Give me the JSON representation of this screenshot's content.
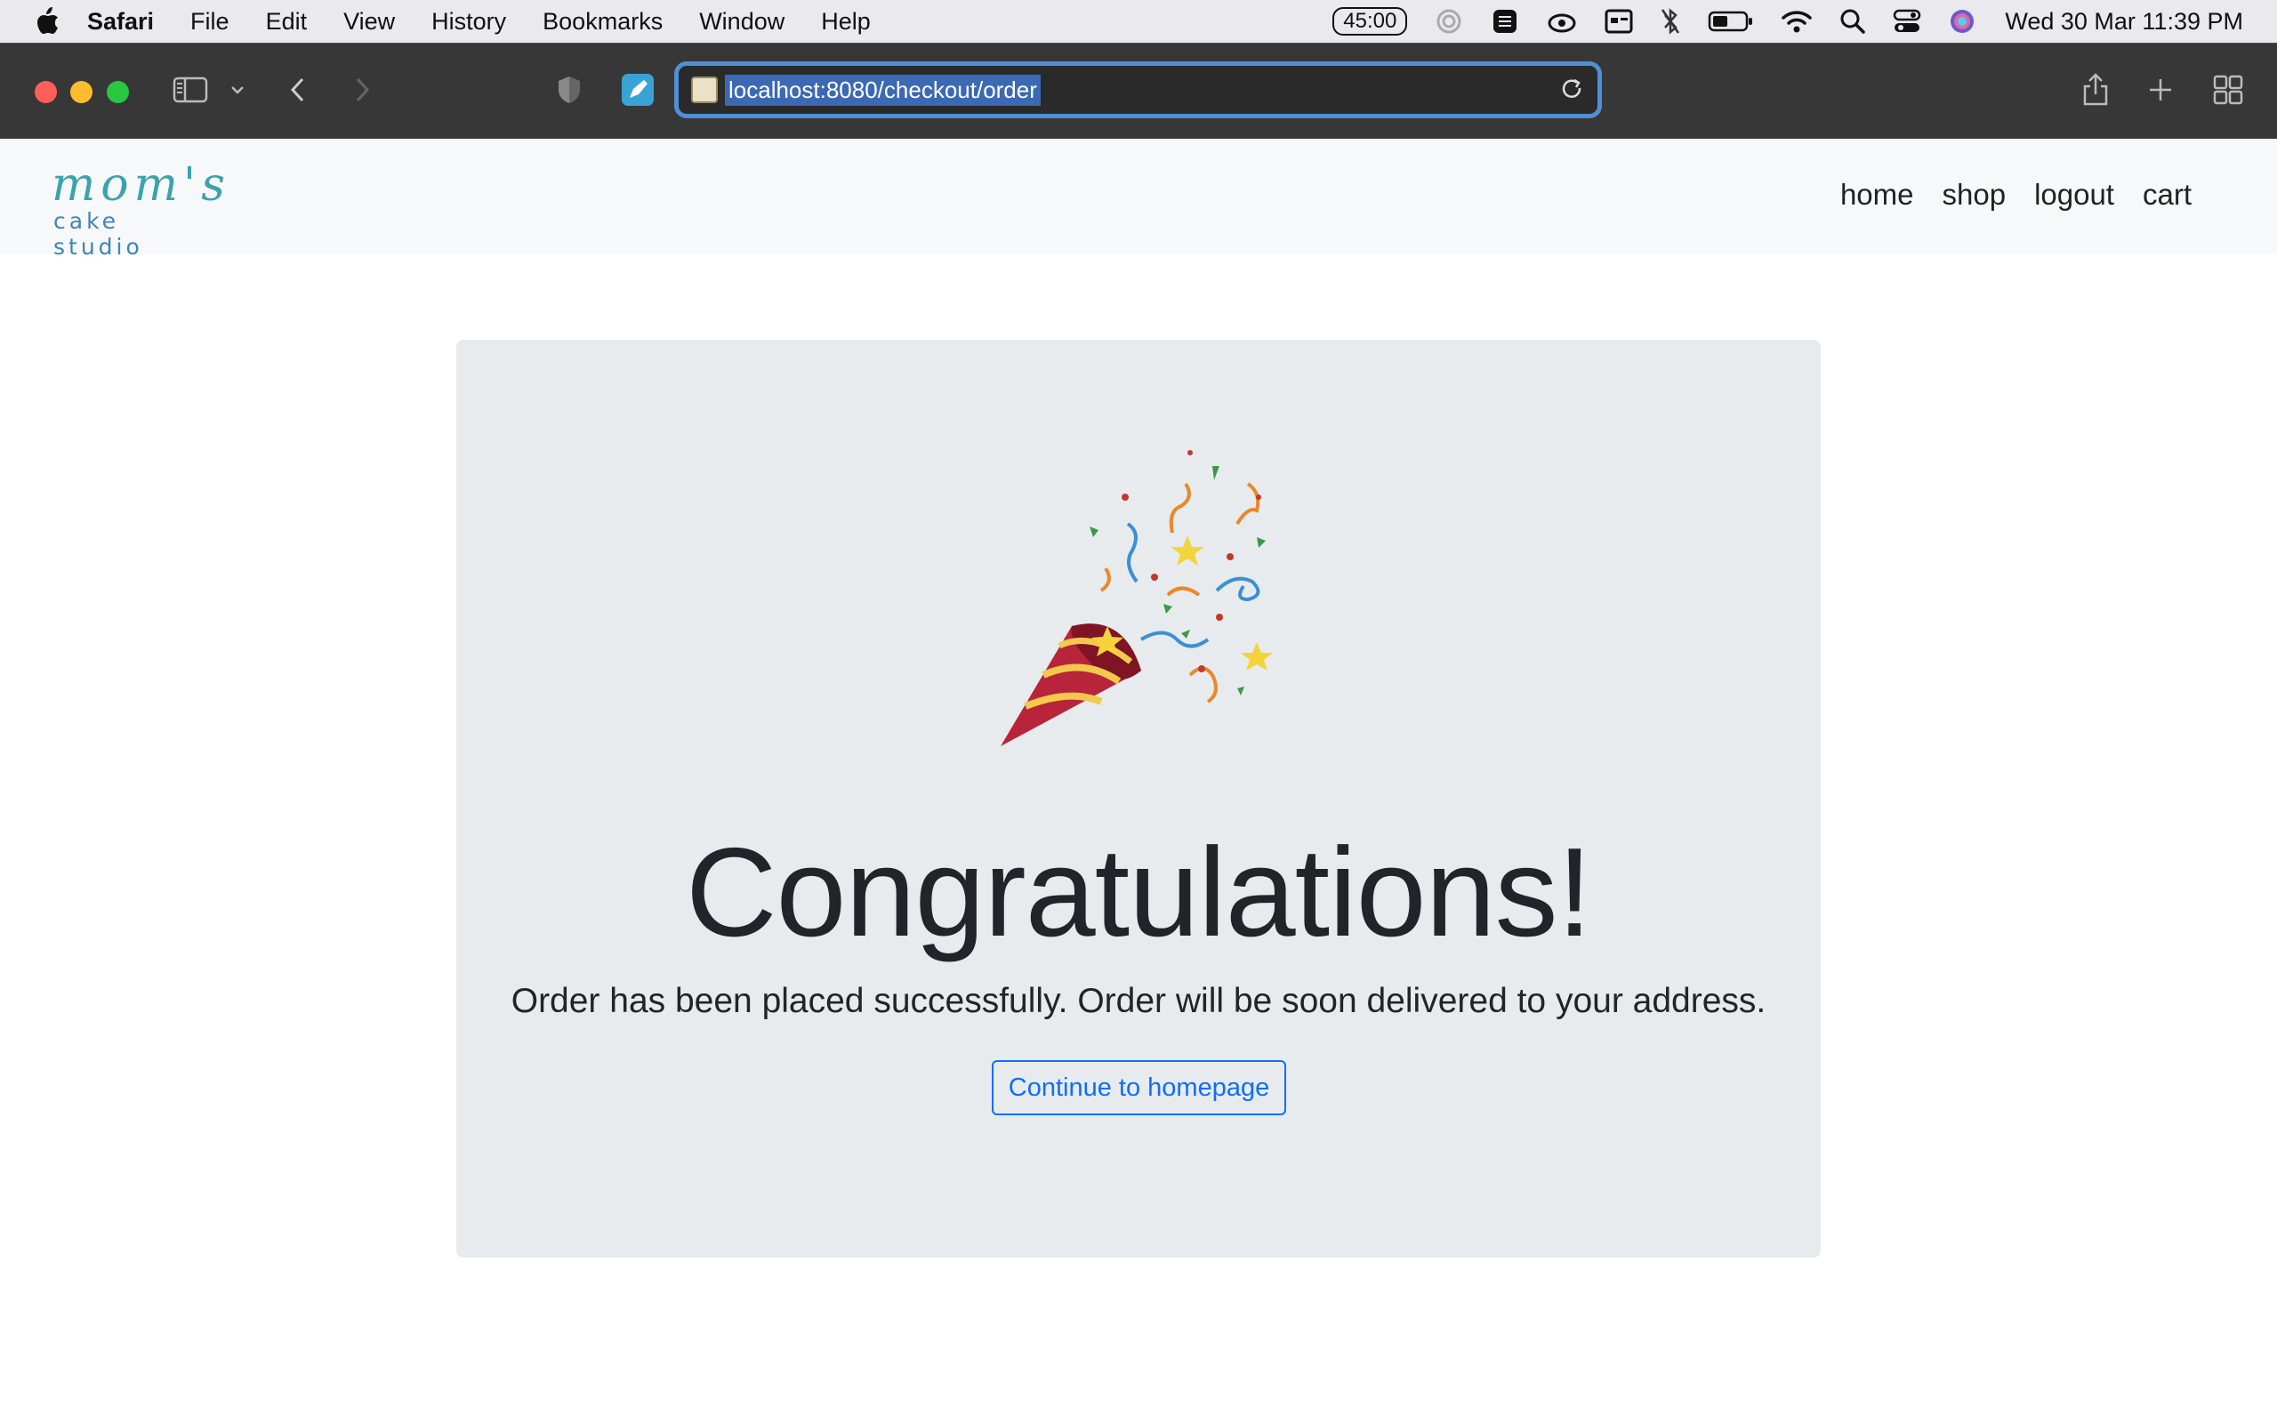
{
  "menubar": {
    "app_name": "Safari",
    "items": [
      "File",
      "Edit",
      "View",
      "History",
      "Bookmarks",
      "Window",
      "Help"
    ],
    "timer": "45:00",
    "clock": "Wed 30 Mar  11:39 PM"
  },
  "browser": {
    "url": "localhost:8080/checkout/order"
  },
  "site": {
    "logo_top": "mom's",
    "logo_bottom": "cake studio",
    "nav": [
      "home",
      "shop",
      "logout",
      "cart"
    ]
  },
  "confirmation": {
    "headline": "Congratulations!",
    "message_strong": "Order has been placed successfully.",
    "message_rest": " Order will be soon delivered to your address.",
    "button_label": "Continue to homepage",
    "icon": "party-popper-icon"
  },
  "colors": {
    "accent": "#0d6efd",
    "jumbotron_bg": "#e8ebee",
    "toolbar_bg": "#373737"
  }
}
